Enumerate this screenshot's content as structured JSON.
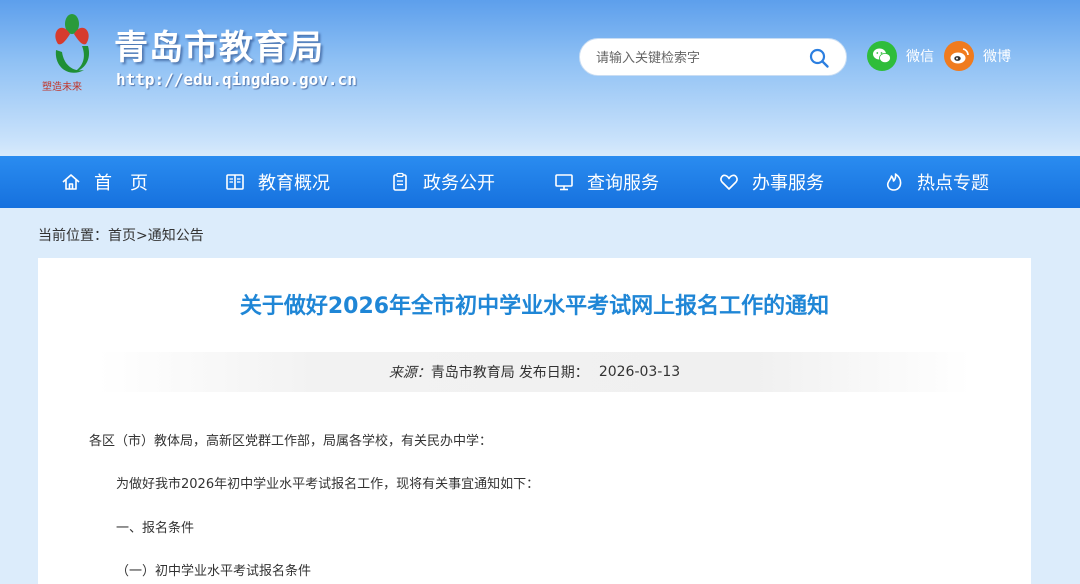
{
  "header": {
    "site_title": "青岛市教育局",
    "site_url": "http://edu.qingdao.gov.cn",
    "logo_icon": "qingdao-education-logo-icon",
    "search": {
      "placeholder": "请输入关键检索字",
      "value": ""
    },
    "social": [
      {
        "label": "微信",
        "icon": "wechat-icon",
        "color": "#2fbd3b"
      },
      {
        "label": "微博",
        "icon": "weibo-icon",
        "color": "#f07b1e"
      }
    ]
  },
  "nav": {
    "items": [
      {
        "label": "首　页",
        "icon": "home-icon"
      },
      {
        "label": "教育概况",
        "icon": "book-icon"
      },
      {
        "label": "政务公开",
        "icon": "clipboard-icon"
      },
      {
        "label": "查询服务",
        "icon": "monitor-icon"
      },
      {
        "label": "办事服务",
        "icon": "heart-icon"
      },
      {
        "label": "热点专题",
        "icon": "flame-icon"
      }
    ]
  },
  "breadcrumb": {
    "prefix": "当前位置：",
    "home": "首页",
    "separator": ">",
    "current": "通知公告"
  },
  "article": {
    "title": "关于做好2026年全市初中学业水平考试网上报名工作的通知",
    "source_label": "来源：",
    "source_value": "青岛市教育局",
    "date_label": "发布日期：",
    "date_value": "2026-03-13",
    "paragraphs": [
      "各区（市）教体局，高新区党群工作部，局属各学校，有关民办中学：",
      "为做好我市2026年初中学业水平考试报名工作，现将有关事宜通知如下：",
      "一、报名条件",
      "（一）初中学业水平考试报名条件"
    ]
  },
  "colors": {
    "nav_bg": "#1a7ee6",
    "title_blue": "#1f86d6",
    "page_bg": "#dcecfb"
  }
}
